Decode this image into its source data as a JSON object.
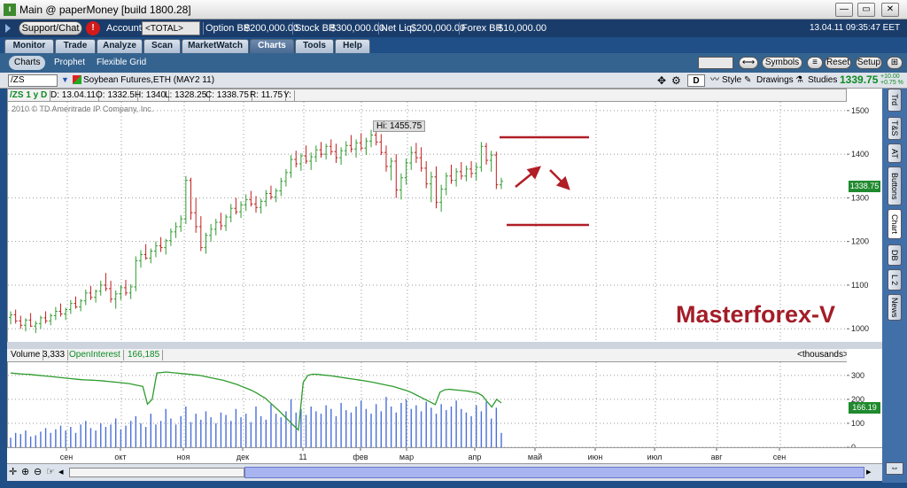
{
  "window": {
    "title": "Main @ paperMoney [build 1800.28]",
    "logo": "td-logo-icon"
  },
  "account_bar": {
    "support_label": "Support/Chat",
    "alert": "!",
    "account_label": "Account",
    "account_value": "<TOTAL> (A...",
    "option_bp_label": "Option BP",
    "option_bp": "$200,000.00",
    "stock_bp_label": "Stock BP",
    "stock_bp": "$300,000.00",
    "net_liq_label": "Net Liq",
    "net_liq": "$200,000.00",
    "forex_bp_label": "Forex BP",
    "forex_bp": "$10,000.00",
    "datetime": "13.04.11 09:35:47 EET"
  },
  "main_tabs": [
    "Monitor",
    "Trade",
    "Analyze",
    "Scan",
    "MarketWatch",
    "Charts",
    "Tools",
    "Help"
  ],
  "main_tabs_active": "Charts",
  "sub_tabs": [
    "Charts",
    "Prophet",
    "Flexible Grid"
  ],
  "sub_tabs_active": "Charts",
  "toolbar": {
    "symbols": "Symbols",
    "reset": "Reset",
    "setup": "Setup"
  },
  "symbol_bar": {
    "symbol": "/ZS",
    "description": "Soybean Futures,ETH (MAY2 11)",
    "d_label": "D",
    "style": "Style",
    "drawings": "Drawings",
    "studies": "Studies",
    "last": "1339.75",
    "change_up": "+10.00",
    "change_pct": "+0.75 %"
  },
  "info_bar": {
    "symbol_period": "/ZS 1 y D",
    "date": "D: 13.04.11",
    "open": "O: 1332.5",
    "high": "H: 1340",
    "low": "L: 1328.25",
    "close": "C: 1338.75",
    "range": "R: 11.75",
    "y": "Y:"
  },
  "copyright": "2010 © TD Ameritrade IP Company, Inc.",
  "hi_label": "Hi: 1455.75",
  "watermark": "Masterforex-V",
  "price_tag": "1338.75",
  "volume_tag": "166.19",
  "volume_header": {
    "volume_label": "Volume",
    "volume_value": "3,333",
    "oi_label": "OpenInterest",
    "oi_value": "166,185",
    "units": "<thousands>"
  },
  "right_tabs": [
    "Trd",
    "T&S",
    "AT",
    "Buttons",
    "Chart",
    "DB",
    "L 2",
    "News"
  ],
  "right_tabs_active": "Chart",
  "colors": {
    "up": "#2e9c2e",
    "down": "#c21f1f",
    "oi": "#2e9c2e",
    "volume": "#4a6fd8",
    "watermark": "#a31d28"
  },
  "chart_data": {
    "type": "candlestick",
    "price_axis": {
      "ticks": [
        1000,
        1100,
        1200,
        1300,
        1400,
        1500
      ],
      "range": [
        970,
        1520
      ]
    },
    "volume_axis": {
      "ticks": [
        0,
        100,
        200,
        300
      ],
      "range": [
        0,
        340
      ]
    },
    "month_labels": [
      "сен",
      "окт",
      "ноя",
      "дек",
      "11",
      "фев",
      "мар",
      "апр",
      "май",
      "июн",
      "июл",
      "авг",
      "сен"
    ],
    "ohlc": [
      [
        1026,
        1040,
        1010,
        1032
      ],
      [
        1032,
        1044,
        1012,
        1018
      ],
      [
        1018,
        1030,
        1000,
        1008
      ],
      [
        1008,
        1024,
        994,
        1020
      ],
      [
        1020,
        1036,
        1004,
        1006
      ],
      [
        1006,
        1018,
        990,
        1012
      ],
      [
        1012,
        1030,
        1000,
        1025
      ],
      [
        1025,
        1040,
        1012,
        1018
      ],
      [
        1018,
        1035,
        1008,
        1030
      ],
      [
        1030,
        1050,
        1020,
        1040
      ],
      [
        1040,
        1058,
        1028,
        1034
      ],
      [
        1034,
        1048,
        1020,
        1044
      ],
      [
        1044,
        1066,
        1034,
        1058
      ],
      [
        1058,
        1074,
        1046,
        1050
      ],
      [
        1050,
        1068,
        1040,
        1064
      ],
      [
        1064,
        1090,
        1054,
        1082
      ],
      [
        1082,
        1098,
        1066,
        1072
      ],
      [
        1072,
        1090,
        1060,
        1086
      ],
      [
        1086,
        1110,
        1076,
        1100
      ],
      [
        1100,
        1128,
        1086,
        1092
      ],
      [
        1092,
        1110,
        1060,
        1068
      ],
      [
        1068,
        1088,
        1046,
        1080
      ],
      [
        1080,
        1100,
        1066,
        1094
      ],
      [
        1094,
        1112,
        1076,
        1082
      ],
      [
        1082,
        1102,
        1068,
        1096
      ],
      [
        1096,
        1166,
        1086,
        1156
      ],
      [
        1156,
        1180,
        1140,
        1170
      ],
      [
        1170,
        1194,
        1158,
        1162
      ],
      [
        1162,
        1184,
        1150,
        1178
      ],
      [
        1178,
        1200,
        1164,
        1190
      ],
      [
        1190,
        1210,
        1176,
        1186
      ],
      [
        1186,
        1206,
        1170,
        1202
      ],
      [
        1202,
        1230,
        1190,
        1222
      ],
      [
        1222,
        1244,
        1208,
        1234
      ],
      [
        1234,
        1260,
        1222,
        1252
      ],
      [
        1252,
        1350,
        1240,
        1340
      ],
      [
        1340,
        1346,
        1250,
        1266
      ],
      [
        1266,
        1300,
        1220,
        1234
      ],
      [
        1234,
        1258,
        1178,
        1186
      ],
      [
        1186,
        1220,
        1172,
        1214
      ],
      [
        1214,
        1240,
        1200,
        1228
      ],
      [
        1228,
        1252,
        1214,
        1244
      ],
      [
        1244,
        1266,
        1226,
        1236
      ],
      [
        1236,
        1262,
        1224,
        1256
      ],
      [
        1256,
        1286,
        1244,
        1276
      ],
      [
        1276,
        1300,
        1262,
        1268
      ],
      [
        1268,
        1292,
        1254,
        1284
      ],
      [
        1284,
        1308,
        1270,
        1296
      ],
      [
        1296,
        1316,
        1280,
        1286
      ],
      [
        1286,
        1304,
        1266,
        1278
      ],
      [
        1278,
        1298,
        1264,
        1292
      ],
      [
        1292,
        1318,
        1280,
        1310
      ],
      [
        1310,
        1328,
        1296,
        1302
      ],
      [
        1302,
        1322,
        1290,
        1316
      ],
      [
        1316,
        1346,
        1304,
        1338
      ],
      [
        1338,
        1366,
        1326,
        1358
      ],
      [
        1358,
        1398,
        1346,
        1388
      ],
      [
        1388,
        1408,
        1370,
        1378
      ],
      [
        1378,
        1402,
        1362,
        1396
      ],
      [
        1396,
        1420,
        1378,
        1384
      ],
      [
        1384,
        1404,
        1364,
        1394
      ],
      [
        1394,
        1420,
        1382,
        1410
      ],
      [
        1410,
        1428,
        1392,
        1400
      ],
      [
        1400,
        1424,
        1388,
        1418
      ],
      [
        1418,
        1434,
        1398,
        1406
      ],
      [
        1406,
        1424,
        1380,
        1392
      ],
      [
        1392,
        1416,
        1376,
        1408
      ],
      [
        1408,
        1430,
        1396,
        1420
      ],
      [
        1420,
        1444,
        1404,
        1412
      ],
      [
        1412,
        1434,
        1392,
        1426
      ],
      [
        1426,
        1448,
        1408,
        1414
      ],
      [
        1414,
        1438,
        1398,
        1430
      ],
      [
        1430,
        1456,
        1416,
        1444
      ],
      [
        1444,
        1452,
        1420,
        1428
      ],
      [
        1428,
        1446,
        1398,
        1404
      ],
      [
        1404,
        1420,
        1360,
        1372
      ],
      [
        1372,
        1392,
        1340,
        1384
      ],
      [
        1384,
        1400,
        1300,
        1318
      ],
      [
        1318,
        1356,
        1296,
        1346
      ],
      [
        1346,
        1390,
        1330,
        1380
      ],
      [
        1380,
        1418,
        1364,
        1404
      ],
      [
        1404,
        1426,
        1380,
        1392
      ],
      [
        1392,
        1416,
        1360,
        1368
      ],
      [
        1368,
        1384,
        1322,
        1332
      ],
      [
        1332,
        1360,
        1290,
        1348
      ],
      [
        1348,
        1372,
        1276,
        1290
      ],
      [
        1290,
        1330,
        1268,
        1320
      ],
      [
        1320,
        1358,
        1306,
        1350
      ],
      [
        1350,
        1376,
        1332,
        1340
      ],
      [
        1340,
        1368,
        1326,
        1360
      ],
      [
        1360,
        1382,
        1342,
        1350
      ],
      [
        1350,
        1374,
        1338,
        1366
      ],
      [
        1366,
        1384,
        1346,
        1356
      ],
      [
        1356,
        1380,
        1340,
        1370
      ],
      [
        1370,
        1428,
        1360,
        1418
      ],
      [
        1418,
        1426,
        1376,
        1386
      ],
      [
        1386,
        1408,
        1360,
        1398
      ],
      [
        1398,
        1406,
        1320,
        1330
      ],
      [
        1330,
        1346,
        1320,
        1338
      ]
    ],
    "volume": [
      40,
      60,
      55,
      70,
      45,
      50,
      65,
      80,
      60,
      75,
      90,
      70,
      85,
      60,
      95,
      110,
      80,
      70,
      100,
      85,
      95,
      120,
      75,
      90,
      110,
      130,
      100,
      85,
      140,
      95,
      110,
      160,
      120,
      95,
      130,
      170,
      105,
      140,
      115,
      150,
      125,
      100,
      145,
      135,
      110,
      160,
      125,
      140,
      105,
      170,
      130,
      115,
      180,
      140,
      125,
      150,
      200,
      145,
      160,
      135,
      170,
      150,
      140,
      175,
      160,
      130,
      185,
      155,
      145,
      170,
      195,
      160,
      140,
      180,
      150,
      210,
      170,
      145,
      185,
      200,
      160,
      175,
      150,
      190,
      165,
      140,
      180,
      155,
      170,
      195,
      160,
      145,
      130,
      175,
      150,
      190,
      120,
      165,
      60
    ],
    "open_interest": [
      310,
      308,
      306,
      305,
      304,
      302,
      300,
      298,
      296,
      294,
      292,
      290,
      288,
      286,
      284,
      282,
      281,
      280,
      279,
      278,
      276,
      274,
      272,
      270,
      268,
      266,
      262,
      258,
      254,
      180,
      200,
      310,
      312,
      314,
      312,
      310,
      308,
      306,
      304,
      302,
      300,
      296,
      292,
      288,
      284,
      280,
      274,
      268,
      262,
      254,
      246,
      238,
      228,
      216,
      204,
      186,
      168,
      150,
      130,
      110,
      90,
      72,
      270,
      300,
      305,
      304,
      302,
      300,
      298,
      295,
      292,
      289,
      286,
      283,
      280,
      277,
      274,
      270,
      266,
      262,
      258,
      254,
      248,
      242,
      236,
      228,
      218,
      208,
      198,
      188,
      178,
      230,
      240,
      242,
      240,
      238,
      236,
      234,
      230,
      226,
      215,
      190,
      168,
      200,
      185
    ],
    "hi": 1455.75,
    "last_close": 1338.75
  }
}
